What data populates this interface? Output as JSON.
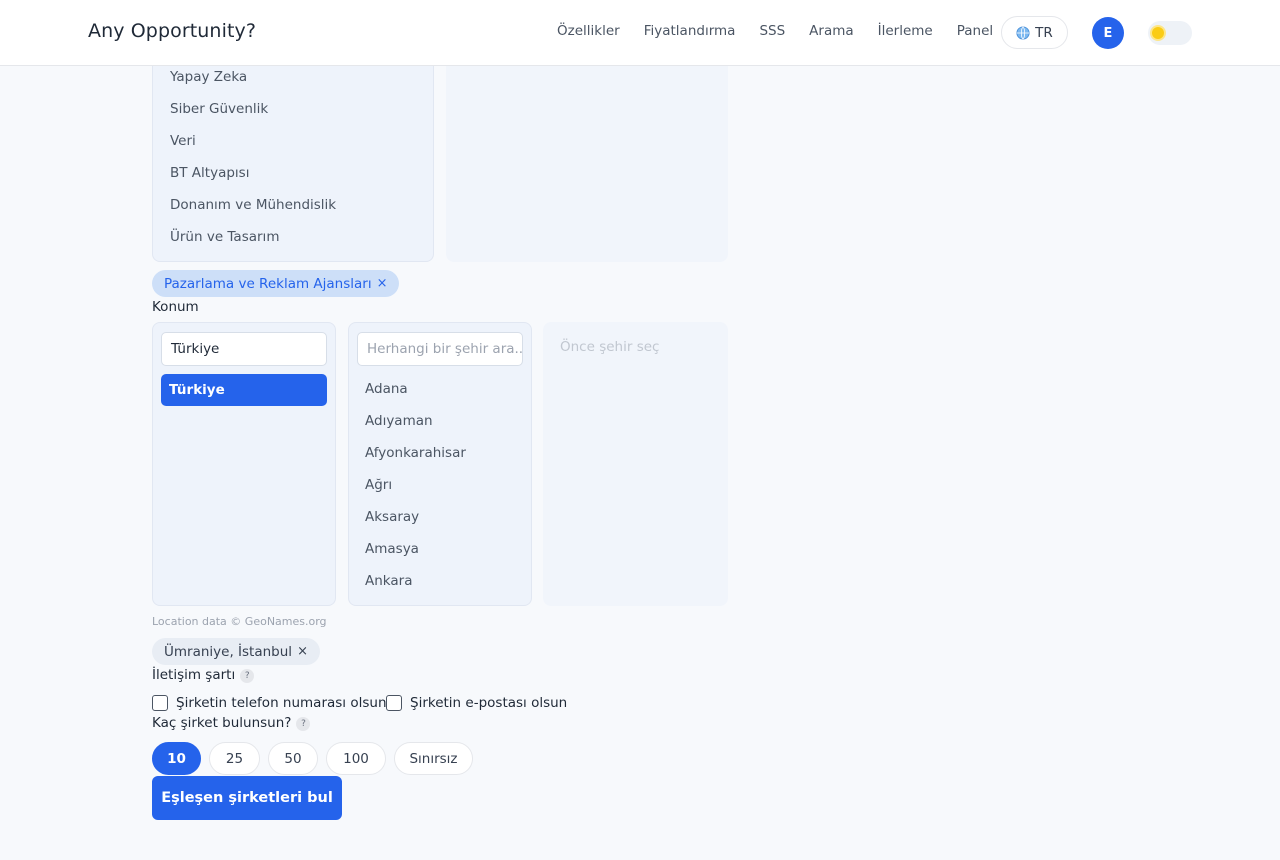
{
  "header": {
    "brand": "Any Opportunity?",
    "nav": [
      "Özellikler",
      "Fiyatlandırma",
      "SSS",
      "Arama",
      "İlerleme",
      "Panel"
    ],
    "lang": "TR",
    "avatar_initial": "E"
  },
  "categories": {
    "items": [
      "Yapay Zeka",
      "Siber Güvenlik",
      "Veri",
      "BT Altyapısı",
      "Donanım ve Mühendislik",
      "Ürün ve Tasarım"
    ]
  },
  "selected_category_chip": "Pazarlama ve Reklam Ajansları",
  "location": {
    "label": "Konum",
    "country_input_value": "Türkiye",
    "selected_country": "Türkiye",
    "city_search_placeholder": "Herhangi bir şehir ara...",
    "cities": [
      "Adana",
      "Adıyaman",
      "Afyonkarahisar",
      "Ağrı",
      "Aksaray",
      "Amasya",
      "Ankara"
    ],
    "district_placeholder": "Önce şehir seç",
    "credit": "Location data © GeoNames.org",
    "selected_chip": "Ümraniye, İstanbul"
  },
  "contact": {
    "label": "İletişim şartı",
    "help": "?",
    "phone_label": "Şirketin telefon numarası olsun",
    "email_label": "Şirketin e-postası olsun"
  },
  "count": {
    "label": "Kaç şirket bulunsun?",
    "help": "?",
    "options": [
      "10",
      "25",
      "50",
      "100",
      "Sınırsız"
    ],
    "selected": "10"
  },
  "submit_label": "Eşleşen şirketleri bul",
  "chip_close": "×",
  "colors": {
    "accent": "#2563eb",
    "chip_blue_bg": "#cddff8",
    "panel_bg": "#eef3fb"
  }
}
